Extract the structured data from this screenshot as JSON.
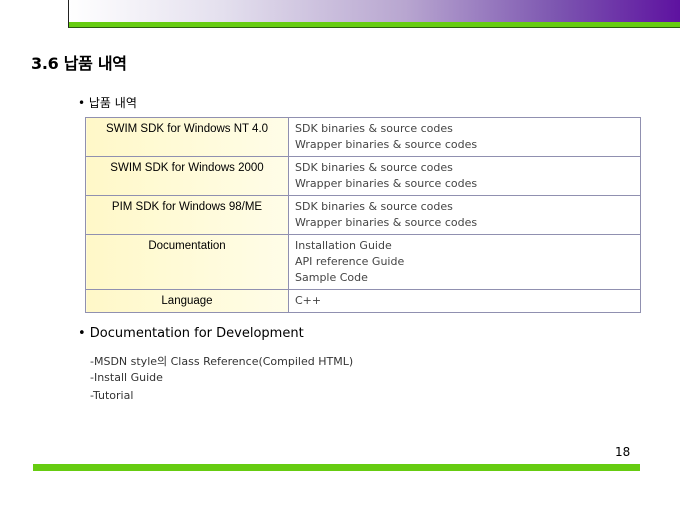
{
  "title": "3.6 납품 내역",
  "bullet1": "• 납품 내역",
  "table": [
    {
      "item": "SWIM SDK for Windows NT 4.0",
      "details": [
        "SDK binaries & source codes",
        "Wrapper binaries & source codes"
      ]
    },
    {
      "item": "SWIM SDK for Windows 2000",
      "details": [
        "SDK binaries & source codes",
        "Wrapper binaries & source codes"
      ]
    },
    {
      "item": "PIM SDK for Windows 98/ME",
      "details": [
        "SDK binaries & source codes",
        "Wrapper binaries & source codes"
      ]
    },
    {
      "item": "Documentation",
      "details": [
        "Installation Guide",
        "API reference Guide",
        "Sample Code"
      ]
    },
    {
      "item": "Language",
      "details": [
        "C++"
      ]
    }
  ],
  "bullet2": "• Documentation for Development",
  "subitems": [
    "-MSDN style의 Class Reference(Compiled HTML)",
    "-Install Guide",
    "-Tutorial"
  ],
  "page_number": "18"
}
